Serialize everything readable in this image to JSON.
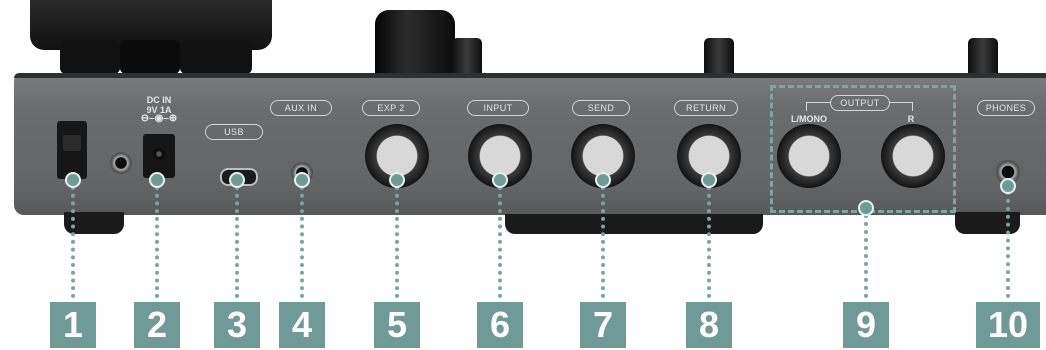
{
  "panel_labels": {
    "dc_in_line1": "DC IN",
    "dc_in_line2": "9V 1A",
    "usb": "USB",
    "aux_in": "AUX IN",
    "exp2": "EXP 2",
    "input": "INPUT",
    "send": "SEND",
    "return": "RETURN",
    "output": "OUTPUT",
    "l_mono": "L/MONO",
    "r": "R",
    "phones": "PHONES"
  },
  "callouts": [
    "1",
    "2",
    "3",
    "4",
    "5",
    "6",
    "7",
    "8",
    "9",
    "10"
  ],
  "colors": {
    "callout": "#6f9a97",
    "panel": "#6b6d6f",
    "hardware": "#111111"
  }
}
